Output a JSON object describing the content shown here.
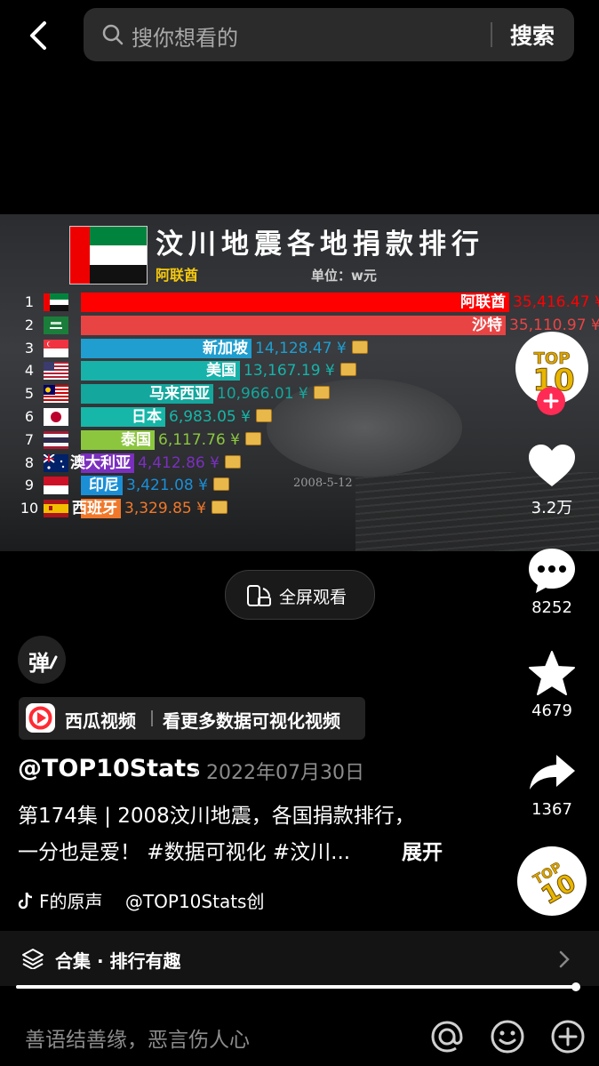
{
  "search": {
    "placeholder": "搜你想看的",
    "button": "搜索"
  },
  "video": {
    "title": "汶川地震各地捐款排行",
    "current_leader": "阿联酋",
    "unit": "单位：w元",
    "monument_date": "2008-5-12",
    "currency": "¥",
    "accent_color": "#ff2b54",
    "bars": [
      {
        "rank": "1",
        "name": "阿联酋",
        "value": "35,416.47",
        "amount": 35416.47,
        "color": "#ff0000",
        "flag": "uae"
      },
      {
        "rank": "2",
        "name": "沙特",
        "value": "35,110.97",
        "amount": 35110.97,
        "color": "#e84444",
        "flag": "saudi"
      },
      {
        "rank": "3",
        "name": "新加坡",
        "value": "14,128.47",
        "amount": 14128.47,
        "color": "#1f9ecf",
        "flag": "singapore"
      },
      {
        "rank": "4",
        "name": "美国",
        "value": "13,167.19",
        "amount": 13167.19,
        "color": "#17b3aa",
        "flag": "usa"
      },
      {
        "rank": "5",
        "name": "马来西亚",
        "value": "10,966.01",
        "amount": 10966.01,
        "color": "#13a79d",
        "flag": "malaysia"
      },
      {
        "rank": "6",
        "name": "日本",
        "value": "6,983.05",
        "amount": 6983.05,
        "color": "#16b6a8",
        "flag": "japan"
      },
      {
        "rank": "7",
        "name": "泰国",
        "value": "6,117.76",
        "amount": 6117.76,
        "color": "#8cc63f",
        "flag": "thailand"
      },
      {
        "rank": "8",
        "name": "澳大利亚",
        "value": "4,412.86",
        "amount": 4412.86,
        "color": "#7b2fbe",
        "flag": "australia"
      },
      {
        "rank": "9",
        "name": "印尼",
        "value": "3,421.08",
        "amount": 3421.08,
        "color": "#1b8fd6",
        "flag": "indonesia"
      },
      {
        "rank": "10",
        "name": "西班牙",
        "value": "3,329.85",
        "amount": 3329.85,
        "color": "#f0782a",
        "flag": "spain"
      }
    ]
  },
  "fullscreen_label": "全屏观看",
  "side": {
    "likes": "3.2万",
    "comments": "8252",
    "favorites": "4679",
    "shares": "1367",
    "avatar_text": "TOP 10"
  },
  "danmu_label": "弹",
  "xigua": {
    "app": "西瓜视频",
    "cta": "看更多数据可视化视频"
  },
  "post": {
    "author": "@TOP10Stats",
    "date": "· 2022年07月30日",
    "line1": "第174集 | 2008汶川地震，各国捐款排行，",
    "line2": "一分也是爱！ #数据可视化 #汶川...",
    "expand": "展开",
    "sound": "F的原声    @TOP10Stats创"
  },
  "collection": "合集 · 排行有趣",
  "comment_placeholder": "善语结善缘，恶言伤人心"
}
